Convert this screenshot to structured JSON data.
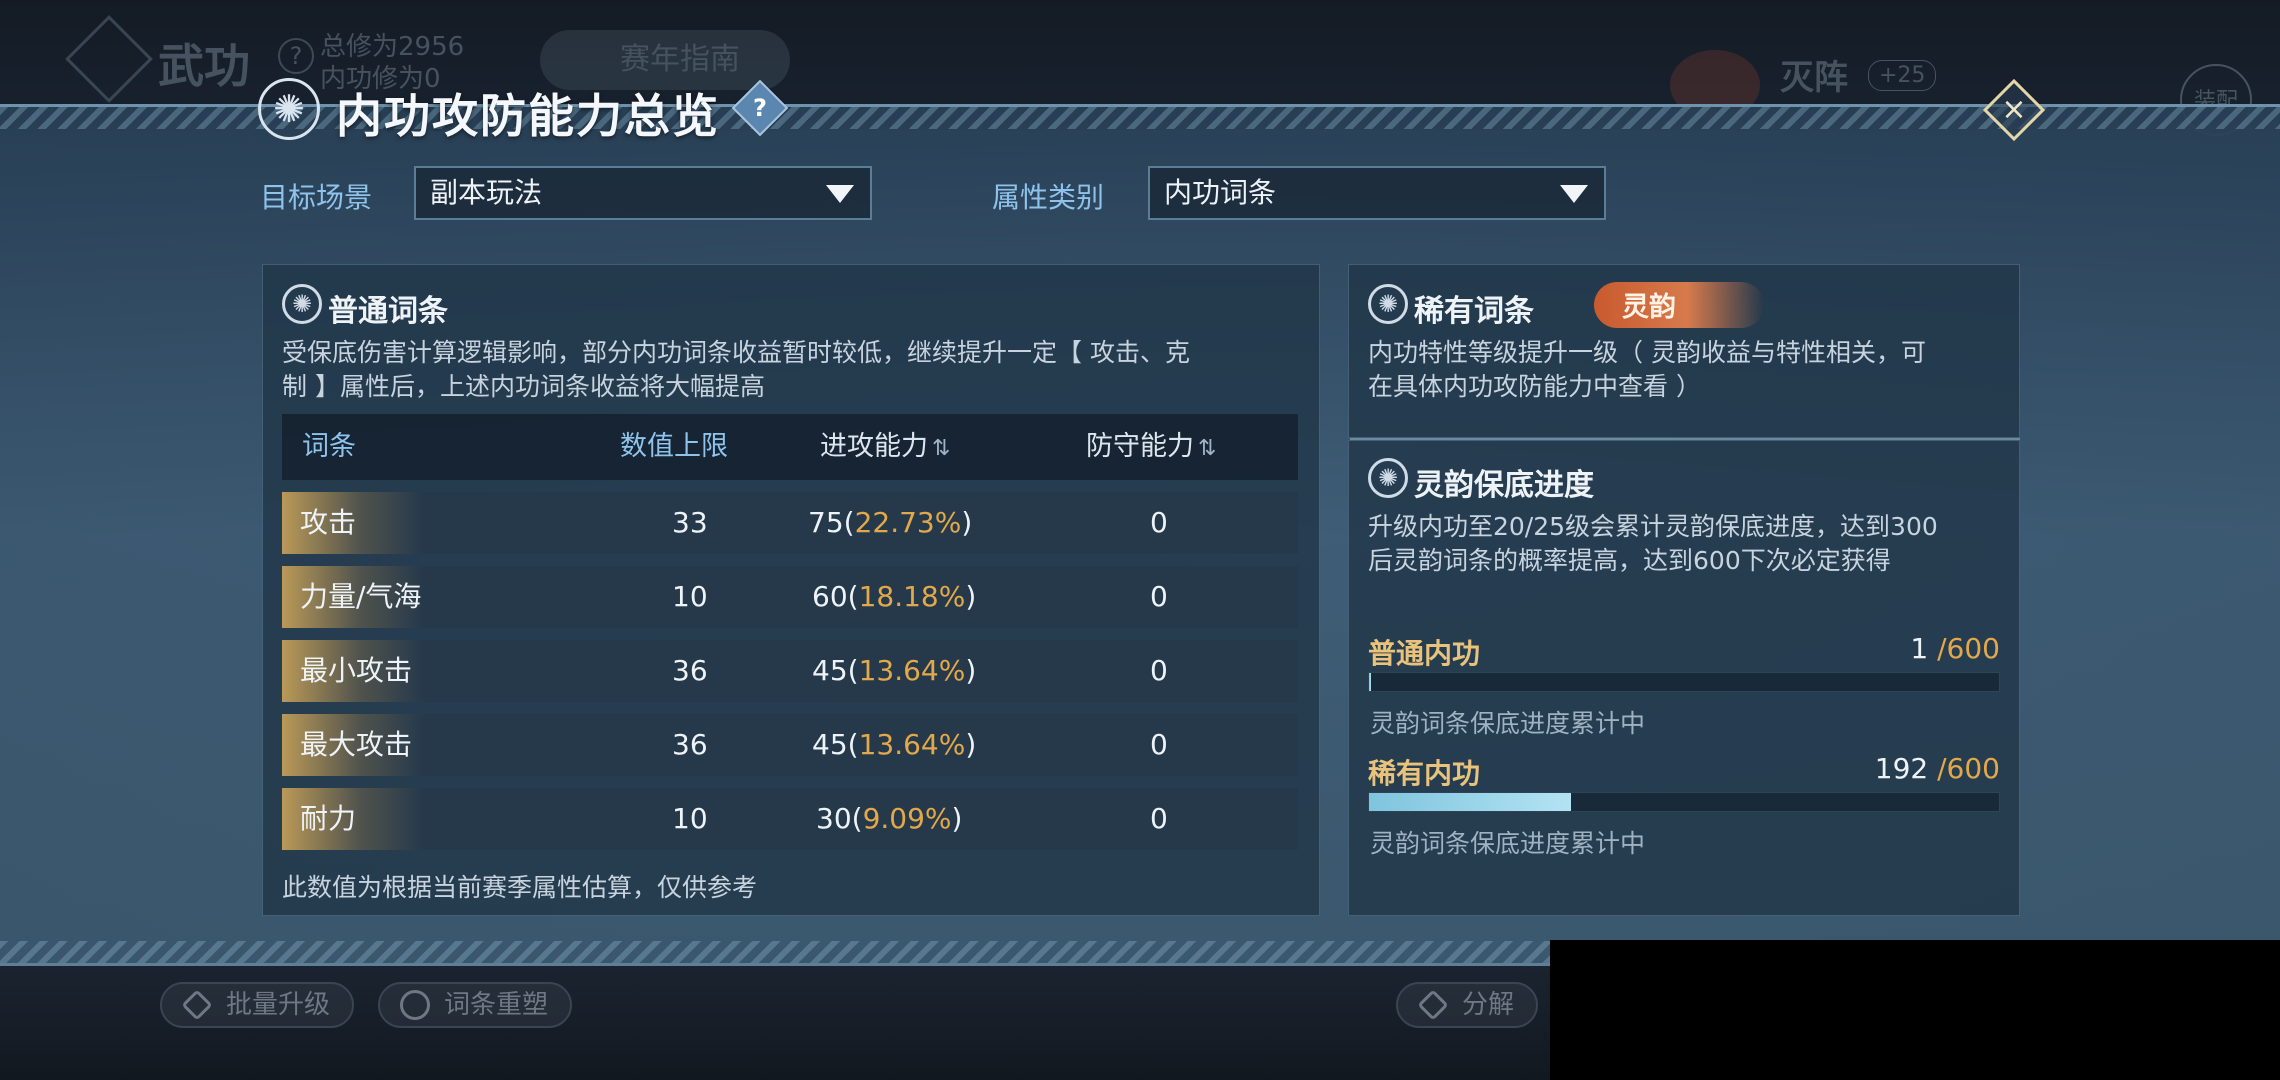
{
  "background": {
    "header": {
      "title": "武功",
      "help": "?",
      "total_cultivation": "总修为2956",
      "inner_cultivation": "内功修为0",
      "season_guide": "赛年指南",
      "faction": "灭阵",
      "faction_bonus": "+25",
      "equip": "装配"
    },
    "bottom": {
      "batch_upgrade": "批量升级",
      "reshape": "词条重塑",
      "decompose": "分解"
    }
  },
  "dialog": {
    "title": "内功攻防能力总览",
    "help": "?",
    "close": "×",
    "filters": {
      "scene_label": "目标场景",
      "scene_value": "副本玩法",
      "attr_label": "属性类别",
      "attr_value": "内功词条"
    },
    "common": {
      "title": "普通词条",
      "desc_line1": "受保底伤害计算逻辑影响，部分内功词条收益暂时较低，继续提升一定【 攻击、克",
      "desc_line2": "制 】属性后，上述内功词条收益将大幅提高",
      "headers": {
        "name": "词条",
        "max": "数值上限",
        "attack": "进攻能力",
        "defense": "防守能力",
        "sort": "⇅"
      },
      "rows": [
        {
          "name": "攻击",
          "max": "33",
          "attack": "75",
          "pct": "22.73%",
          "defense": "0"
        },
        {
          "name": "力量/气海",
          "max": "10",
          "attack": "60",
          "pct": "18.18%",
          "defense": "0"
        },
        {
          "name": "最小攻击",
          "max": "36",
          "attack": "45",
          "pct": "13.64%",
          "defense": "0"
        },
        {
          "name": "最大攻击",
          "max": "36",
          "attack": "45",
          "pct": "13.64%",
          "defense": "0"
        },
        {
          "name": "耐力",
          "max": "10",
          "attack": "30",
          "pct": "9.09%",
          "defense": "0"
        }
      ],
      "paren_open": "(",
      "paren_close": ")",
      "footnote": "此数值为根据当前赛季属性估算，仅供参考"
    },
    "rare": {
      "title": "稀有词条",
      "tag": "灵韵",
      "desc_line1": "内功特性等级提升一级（ 灵韵收益与特性相关，可",
      "desc_line2": "在具体内功攻防能力中查看 ）"
    },
    "guarantee": {
      "title": "灵韵保底进度",
      "desc_line1": "升级内功至20/25级会累计灵韵保底进度，达到300",
      "desc_line2": "后灵韵词条的概率提高，达到600下次必定获得",
      "items": [
        {
          "label": "普通内功",
          "current": "1",
          "max": " /600",
          "progress": 0.0017,
          "note": "灵韵词条保底进度累计中"
        },
        {
          "label": "稀有内功",
          "current": "192",
          "max": " /600",
          "progress": 0.32,
          "note": "灵韵词条保底进度累计中"
        }
      ]
    }
  }
}
